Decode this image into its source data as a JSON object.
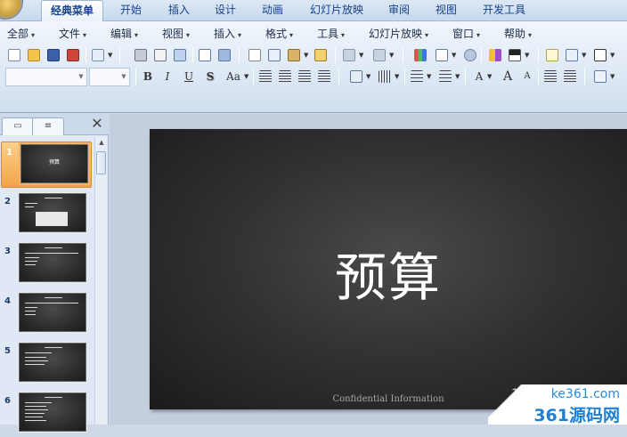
{
  "ribbon_tabs": [
    {
      "label": "经典菜单",
      "active": true
    },
    {
      "label": "开始"
    },
    {
      "label": "插入"
    },
    {
      "label": "设计"
    },
    {
      "label": "动画"
    },
    {
      "label": "幻灯片放映"
    },
    {
      "label": "审阅"
    },
    {
      "label": "视图"
    },
    {
      "label": "开发工具"
    }
  ],
  "menu_bar": [
    {
      "label": "全部"
    },
    {
      "label": "文件"
    },
    {
      "label": "编辑"
    },
    {
      "label": "视图"
    },
    {
      "label": "插入"
    },
    {
      "label": "格式"
    },
    {
      "label": "工具"
    },
    {
      "label": "幻灯片放映"
    },
    {
      "label": "窗口"
    },
    {
      "label": "帮助"
    }
  ],
  "menu_arrow": "▾",
  "format_buttons": {
    "bold": "B",
    "italic": "I",
    "underline": "U",
    "shadow": "S",
    "change_case": "Aa",
    "font_color": "A",
    "grow_font": "A",
    "shrink_font": "A"
  },
  "left_pane": {
    "close_glyph": "✕",
    "slides": [
      {
        "num": "1",
        "selected": true
      },
      {
        "num": "2"
      },
      {
        "num": "3"
      },
      {
        "num": "4"
      },
      {
        "num": "5"
      },
      {
        "num": "6"
      }
    ]
  },
  "slide": {
    "title": "预算",
    "footer": "Confidential Information",
    "number": "1"
  },
  "watermark": {
    "domain": "ke361.com",
    "name": "361源码网"
  },
  "colors": {
    "accent": "#15428b",
    "selection": "#f2a44a",
    "slide_bg": "#2b2b2b"
  }
}
